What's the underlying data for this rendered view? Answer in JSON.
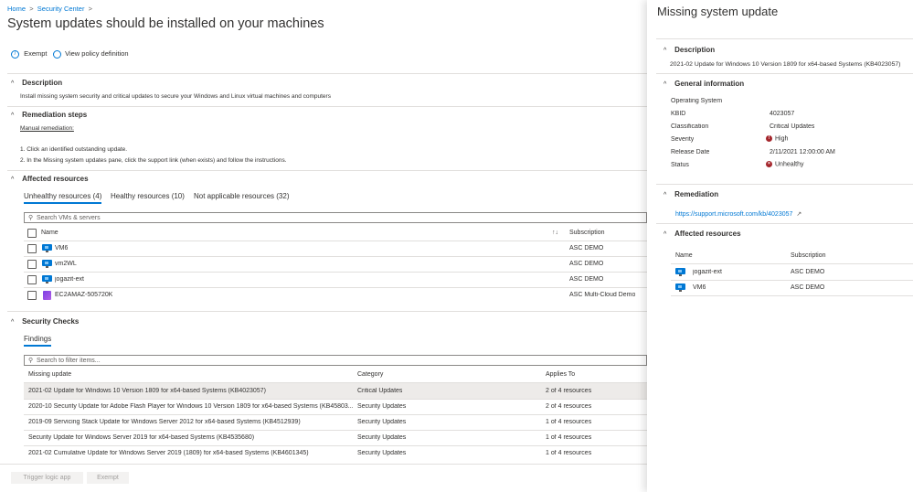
{
  "breadcrumb": {
    "home": "Home",
    "security_center": "Security Center"
  },
  "page_title": "System updates should be installed on your machines",
  "more_label": "···",
  "toolbar": {
    "exempt": "Exempt",
    "view_policy": "View policy definition"
  },
  "description": {
    "title": "Description",
    "text": "Install missing system security and critical updates to secure your Windows and Linux virtual machines and computers"
  },
  "remediation": {
    "title": "Remediation steps",
    "manual_label": "Manual remediation:",
    "steps": [
      "1. Click an identified outstanding update.",
      "2. In the Missing system updates pane, click the support link (when exists) and follow the instructions."
    ]
  },
  "affected": {
    "title": "Affected resources",
    "tabs": [
      "Unhealthy resources (4)",
      "Healthy resources (10)",
      "Not applicable resources (32)"
    ],
    "search_placeholder": "Search VMs & servers",
    "columns": {
      "name": "Name",
      "subscription": "Subscription"
    },
    "rows": [
      {
        "name": "VM6",
        "subscription": "ASC DEMO",
        "icon": "vm-icon"
      },
      {
        "name": "vm2WL",
        "subscription": "ASC DEMO",
        "icon": "vm-icon"
      },
      {
        "name": "jogazit-ext",
        "subscription": "ASC DEMO",
        "icon": "vm-icon"
      },
      {
        "name": "EC2AMAZ-505720K",
        "subscription": "ASC Multi-Cloud Demo",
        "icon": "ec2-icon"
      }
    ]
  },
  "security_checks": {
    "title": "Security Checks",
    "tab": "Findings",
    "search_placeholder": "Search to filter items...",
    "columns": {
      "update": "Missing update",
      "category": "Category",
      "applies": "Applies To"
    },
    "rows": [
      {
        "update": "2021-02 Update for Windows 10 Version 1809 for x64-based Systems (KB4023057)",
        "category": "Critical Updates",
        "applies": "2 of 4 resources"
      },
      {
        "update": "2020-10 Security Update for Adobe Flash Player for Windows 10 Version 1809 for x64-based Systems (KB45803...",
        "category": "Security Updates",
        "applies": "2 of 4 resources"
      },
      {
        "update": "2019-09 Servicing Stack Update for Windows Server 2012 for x64-based Systems (KB4512939)",
        "category": "Security Updates",
        "applies": "1 of 4 resources"
      },
      {
        "update": "Security Update for Windows Server 2019 for x64-based Systems (KB4535680)",
        "category": "Security Updates",
        "applies": "1 of 4 resources"
      },
      {
        "update": "2021-02 Cumulative Update for Windows Server 2019 (1809) for x64-based Systems (KB4601345)",
        "category": "Security Updates",
        "applies": "1 of 4 resources"
      }
    ]
  },
  "footer": {
    "trigger": "Trigger logic app",
    "exempt": "Exempt"
  },
  "panel": {
    "title": "Missing system update",
    "description_title": "Description",
    "description_text": "2021-02 Update for Windows 10 Version 1809 for x64-based Systems (KB4023057)",
    "general_title": "General information",
    "general": [
      {
        "label": "Operating System",
        "value": ""
      },
      {
        "label": "KBID",
        "value": "4023057"
      },
      {
        "label": "Classification",
        "value": "Critical Updates"
      },
      {
        "label": "Severity",
        "value": "High"
      },
      {
        "label": "Release Date",
        "value": "2/11/2021 12:00:00 AM"
      },
      {
        "label": "Status",
        "value": "Unhealthy"
      }
    ],
    "remediation_title": "Remediation",
    "remediation_link": "https://support.microsoft.com/kb/4023057",
    "affected_title": "Affected resources",
    "affected_columns": {
      "name": "Name",
      "subscription": "Subscription"
    },
    "affected_rows": [
      {
        "name": "jogazit-ext",
        "subscription": "ASC DEMO"
      },
      {
        "name": "VM6",
        "subscription": "ASC DEMO"
      }
    ]
  },
  "colors": {
    "accent": "#0078d4",
    "error": "#a4262c",
    "selected_row": "#edebe9"
  }
}
